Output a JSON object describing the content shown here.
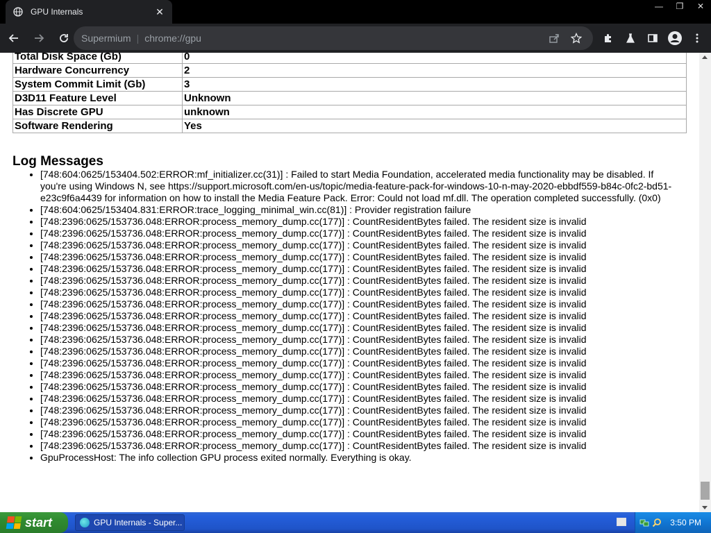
{
  "tab": {
    "title": "GPU Internals",
    "icon": "globe-icon",
    "close": "✕"
  },
  "window_controls": {
    "minimize": "—",
    "restore": "❐",
    "close": "✕"
  },
  "omnibox": {
    "host": "Supermium",
    "separator": "|",
    "url": "chrome://gpu"
  },
  "info_rows": [
    {
      "key": "Total Disk Space (Gb)",
      "value": "0"
    },
    {
      "key": "Hardware Concurrency",
      "value": "2"
    },
    {
      "key": "System Commit Limit (Gb)",
      "value": "3"
    },
    {
      "key": "D3D11 Feature Level",
      "value": "Unknown"
    },
    {
      "key": "Has Discrete GPU",
      "value": "unknown"
    },
    {
      "key": "Software Rendering",
      "value": "Yes"
    }
  ],
  "log": {
    "heading": "Log Messages",
    "messages": [
      "[748:604:0625/153404.502:ERROR:mf_initializer.cc(31)] : Failed to start Media Foundation, accelerated media functionality may be disabled. If you're using Windows N, see https://support.microsoft.com/en-us/topic/media-feature-pack-for-windows-10-n-may-2020-ebbdf559-b84c-0fc2-bd51-e23c9f6a4439 for information on how to install the Media Feature Pack. Error: Could not load mf.dll. The operation completed successfully. (0x0)",
      "[748:604:0625/153404.831:ERROR:trace_logging_minimal_win.cc(81)] : Provider registration failure",
      "[748:2396:0625/153736.048:ERROR:process_memory_dump.cc(177)] : CountResidentBytes failed. The resident size is invalid",
      "[748:2396:0625/153736.048:ERROR:process_memory_dump.cc(177)] : CountResidentBytes failed. The resident size is invalid",
      "[748:2396:0625/153736.048:ERROR:process_memory_dump.cc(177)] : CountResidentBytes failed. The resident size is invalid",
      "[748:2396:0625/153736.048:ERROR:process_memory_dump.cc(177)] : CountResidentBytes failed. The resident size is invalid",
      "[748:2396:0625/153736.048:ERROR:process_memory_dump.cc(177)] : CountResidentBytes failed. The resident size is invalid",
      "[748:2396:0625/153736.048:ERROR:process_memory_dump.cc(177)] : CountResidentBytes failed. The resident size is invalid",
      "[748:2396:0625/153736.048:ERROR:process_memory_dump.cc(177)] : CountResidentBytes failed. The resident size is invalid",
      "[748:2396:0625/153736.048:ERROR:process_memory_dump.cc(177)] : CountResidentBytes failed. The resident size is invalid",
      "[748:2396:0625/153736.048:ERROR:process_memory_dump.cc(177)] : CountResidentBytes failed. The resident size is invalid",
      "[748:2396:0625/153736.048:ERROR:process_memory_dump.cc(177)] : CountResidentBytes failed. The resident size is invalid",
      "[748:2396:0625/153736.048:ERROR:process_memory_dump.cc(177)] : CountResidentBytes failed. The resident size is invalid",
      "[748:2396:0625/153736.048:ERROR:process_memory_dump.cc(177)] : CountResidentBytes failed. The resident size is invalid",
      "[748:2396:0625/153736.048:ERROR:process_memory_dump.cc(177)] : CountResidentBytes failed. The resident size is invalid",
      "[748:2396:0625/153736.048:ERROR:process_memory_dump.cc(177)] : CountResidentBytes failed. The resident size is invalid",
      "[748:2396:0625/153736.048:ERROR:process_memory_dump.cc(177)] : CountResidentBytes failed. The resident size is invalid",
      "[748:2396:0625/153736.048:ERROR:process_memory_dump.cc(177)] : CountResidentBytes failed. The resident size is invalid",
      "[748:2396:0625/153736.048:ERROR:process_memory_dump.cc(177)] : CountResidentBytes failed. The resident size is invalid",
      "[748:2396:0625/153736.048:ERROR:process_memory_dump.cc(177)] : CountResidentBytes failed. The resident size is invalid",
      "[748:2396:0625/153736.048:ERROR:process_memory_dump.cc(177)] : CountResidentBytes failed. The resident size is invalid",
      "[748:2396:0625/153736.048:ERROR:process_memory_dump.cc(177)] : CountResidentBytes failed. The resident size is invalid",
      "GpuProcessHost: The info collection GPU process exited normally. Everything is okay."
    ]
  },
  "taskbar": {
    "start_label": "start",
    "task_item": "GPU Internals - Super...",
    "clock": "3:50 PM"
  },
  "colors": {
    "chrome_dark": "#202124",
    "taskbar_blue": "#245edb",
    "start_green": "#2f8b2f"
  }
}
